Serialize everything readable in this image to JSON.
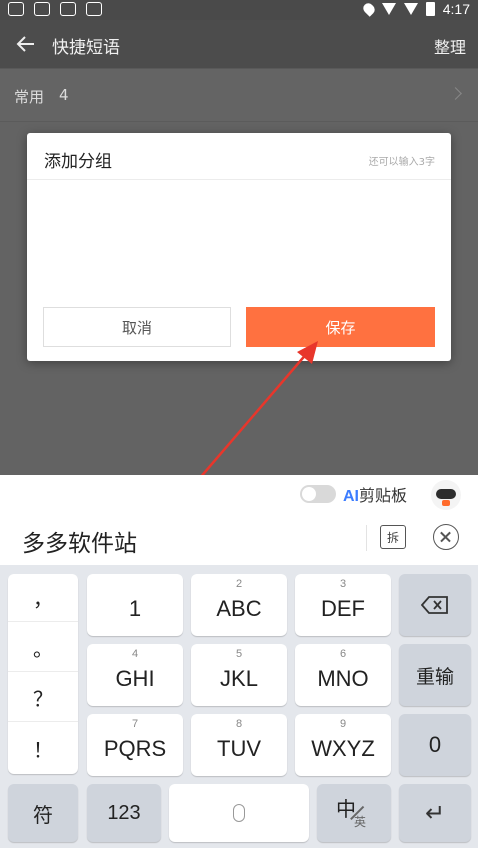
{
  "status_bar": {
    "time": "4:17"
  },
  "app_bar": {
    "title": "快捷短语",
    "action": "整理"
  },
  "group": {
    "name": "常用",
    "count": "4"
  },
  "dialog": {
    "title": "添加分组",
    "hint": "还可以输入3字",
    "cancel": "取消",
    "save": "保存"
  },
  "keyboard": {
    "clipboard_prefix": "AI",
    "clipboard_label": "剪贴板",
    "candidate": "多多软件站",
    "split_label": "拆",
    "punct": [
      "，",
      "。",
      "？",
      "！"
    ],
    "keys": [
      {
        "num": "",
        "label": "1"
      },
      {
        "num": "2",
        "label": "ABC"
      },
      {
        "num": "3",
        "label": "DEF"
      },
      {
        "num": "4",
        "label": "GHI"
      },
      {
        "num": "5",
        "label": "JKL"
      },
      {
        "num": "6",
        "label": "MNO"
      },
      {
        "num": "7",
        "label": "PQRS"
      },
      {
        "num": "8",
        "label": "TUV"
      },
      {
        "num": "9",
        "label": "WXYZ"
      }
    ],
    "retype": "重输",
    "zero": "0",
    "symbol": "符",
    "num_mode": "123",
    "lang_zh": "中",
    "lang_en": "英"
  },
  "colors": {
    "accent": "#ff7140",
    "annotation_arrow": "#e8362b"
  }
}
